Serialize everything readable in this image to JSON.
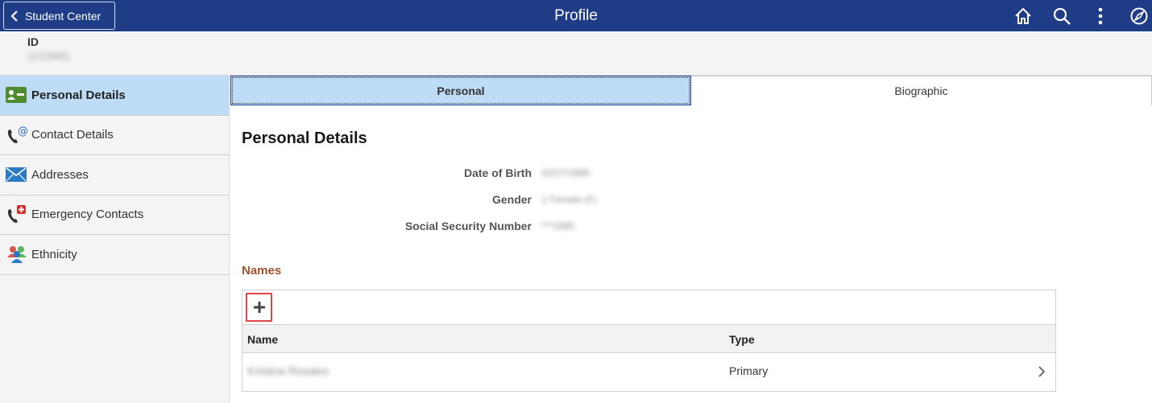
{
  "header": {
    "back_label": "Student Center",
    "title": "Profile",
    "icons": [
      "home-icon",
      "search-icon",
      "more-options-icon",
      "navbar-compass-icon"
    ],
    "bg_color": "#1f3d86"
  },
  "id_strip": {
    "label": "ID",
    "value": "12115601"
  },
  "sidebar": {
    "items": [
      {
        "label": "Personal Details",
        "icon": "id-card-icon",
        "active": true
      },
      {
        "label": "Contact Details",
        "icon": "phone-email-icon",
        "active": false
      },
      {
        "label": "Addresses",
        "icon": "envelope-icon",
        "active": false
      },
      {
        "label": "Emergency Contacts",
        "icon": "emergency-phone-icon",
        "active": false
      },
      {
        "label": "Ethnicity",
        "icon": "people-icon",
        "active": false
      }
    ],
    "active_color": "#bfdcf7"
  },
  "tabs": [
    {
      "label": "Personal",
      "active": true
    },
    {
      "label": "Biographic",
      "active": false
    }
  ],
  "personal_details": {
    "title": "Personal Details",
    "fields": [
      {
        "label": "Date of Birth",
        "value": "02/27/1985"
      },
      {
        "label": "Gender",
        "value": "1 Female (F)"
      },
      {
        "label": "Social Security Number",
        "value": "***1985"
      }
    ]
  },
  "names": {
    "title": "Names",
    "columns": [
      "Name",
      "Type"
    ],
    "rows": [
      {
        "name": "Kristina Rosales",
        "type": "Primary"
      }
    ],
    "accent_color": "#a0522d"
  }
}
